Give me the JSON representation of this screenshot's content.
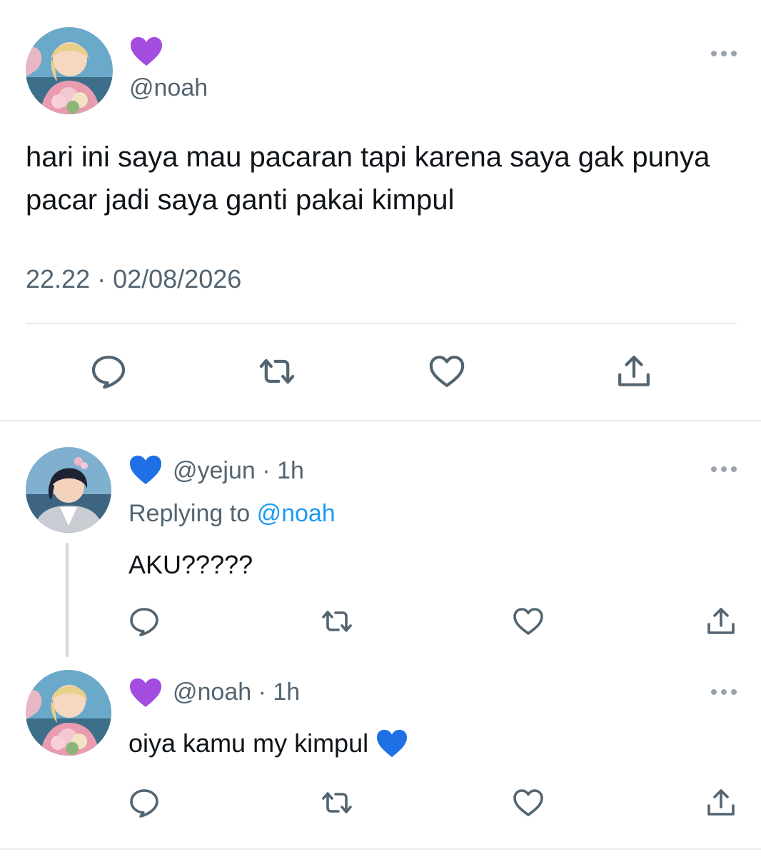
{
  "tweet": {
    "emoji": "💜",
    "handle": "@noah",
    "text": "hari ini saya mau pacaran tapi karena saya gak punya pacar jadi saya ganti pakai kimpul",
    "timestamp": "22.22 · 02/08/2026"
  },
  "replies": [
    {
      "emoji": "💙",
      "handle": "@yejun",
      "time": "1h",
      "replying_prefix": "Replying to",
      "replying_to": "@noah",
      "text": "AKU?????"
    },
    {
      "emoji": "💜",
      "handle": "@noah",
      "time": "1h",
      "text": "oiya kamu my kimpul",
      "text_emoji": "💙"
    }
  ],
  "separator": "·",
  "icons": {
    "reply": "speech-bubble-icon",
    "retweet": "retweet-arrows-icon",
    "like": "heart-outline-icon",
    "share": "share-upload-icon",
    "more": "more-dots-icon"
  },
  "colors": {
    "purple_heart": "#a24ce0",
    "blue_heart": "#1f6fe5",
    "mention": "#1d9bf0",
    "secondary_text": "#536471",
    "icon_gray": "#536471"
  }
}
